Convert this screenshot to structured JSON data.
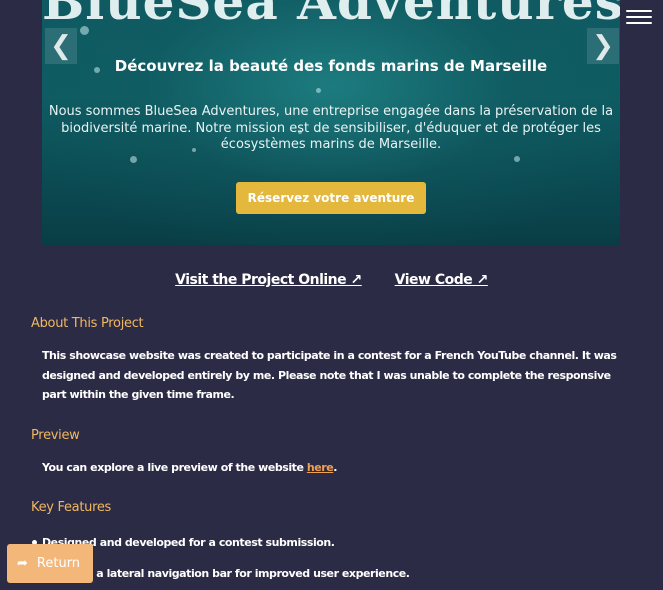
{
  "hero": {
    "title": "BlueSea Adventures",
    "subtitle": "Découvrez la beauté des fonds marins de Marseille",
    "description": "Nous sommes BlueSea Adventures, une entreprise engagée dans la préservation de la biodiversité marine. Notre mission est de sensibiliser, d'éduquer et de protéger les écosystèmes marins de Marseille.",
    "cta_label": "Réservez votre aventure",
    "prev_glyph": "❮",
    "next_glyph": "❯"
  },
  "links": {
    "visit_label": "Visit the Project Online ↗",
    "code_label": "View Code ↗"
  },
  "about": {
    "title": "About This Project",
    "text": "This showcase website was created to participate in a contest for a French YouTube channel. It was designed and developed entirely by me. Please note that I was unable to complete the responsive part within the given time frame."
  },
  "preview": {
    "title": "Preview",
    "text_before": "You can explore a live preview of the website ",
    "link_label": "here",
    "text_after": "."
  },
  "features": {
    "title": "Key Features",
    "items": [
      "Designed and developed for a contest submission.",
      "Features a lateral navigation bar for improved user experience."
    ]
  },
  "return_button": {
    "label": "Return",
    "icon": "share-arrow-icon"
  },
  "menu": {
    "icon": "hamburger-menu-icon"
  },
  "colors": {
    "background": "#2c2b45",
    "accent": "#f0b860",
    "cta": "#e3b83c",
    "return": "#f3b77a",
    "link": "#f0a050"
  }
}
